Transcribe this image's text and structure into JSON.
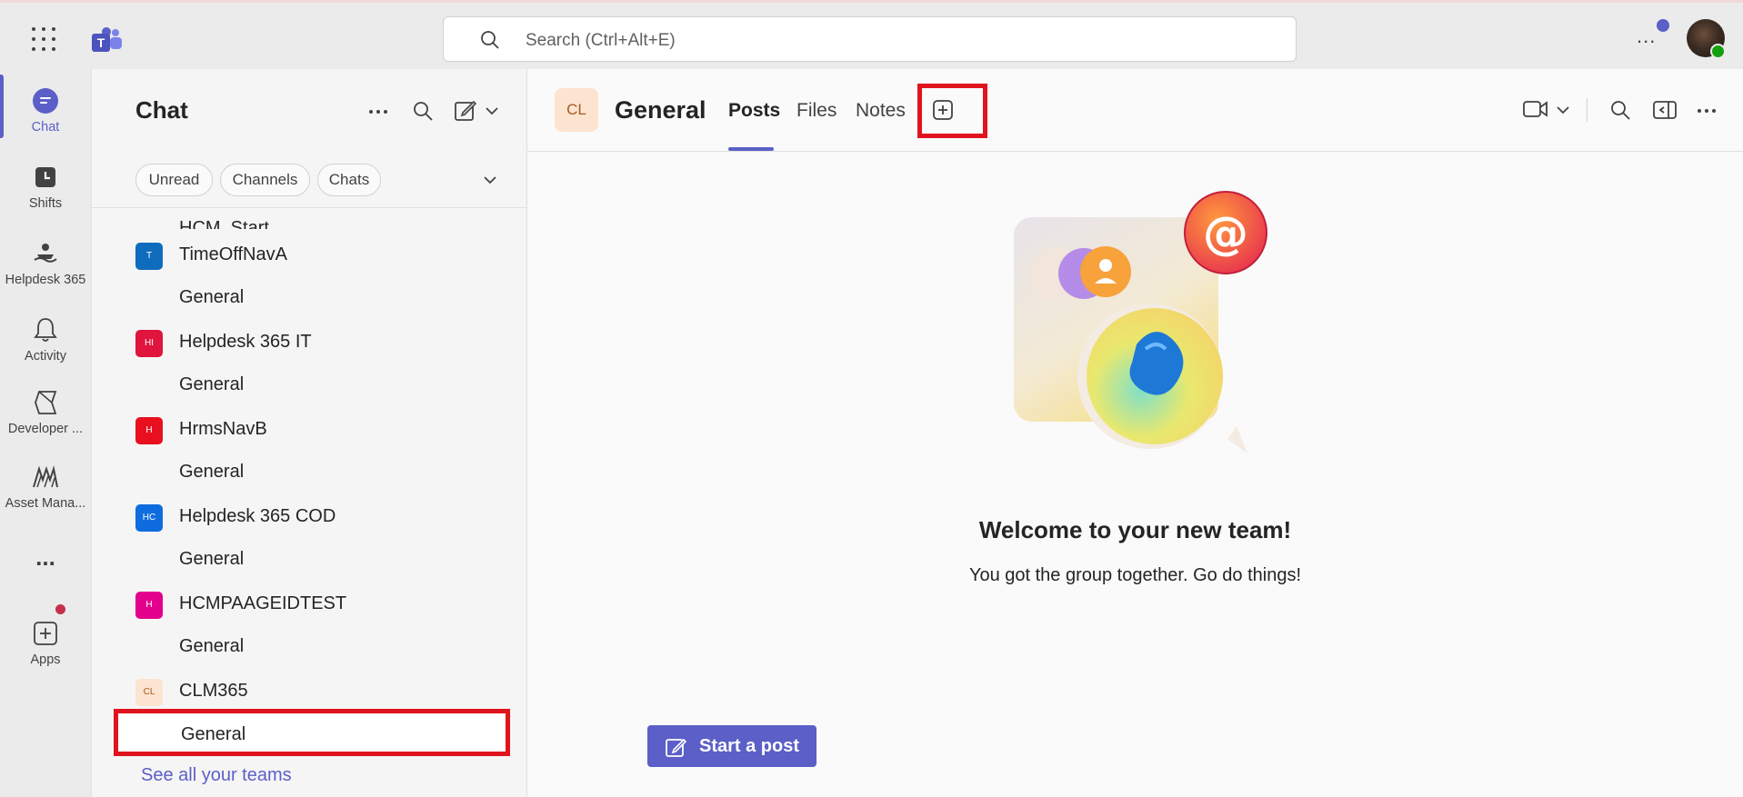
{
  "topbar": {
    "search_placeholder": "Search (Ctrl+Alt+E)",
    "more": "..."
  },
  "rail": {
    "items": [
      {
        "label": "Chat",
        "icon": "chat-icon"
      },
      {
        "label": "Shifts",
        "icon": "shifts-icon"
      },
      {
        "label": "Helpdesk 365",
        "icon": "helpdesk-icon"
      },
      {
        "label": "Activity",
        "icon": "bell-icon"
      },
      {
        "label": "Developer ...",
        "icon": "developer-icon"
      },
      {
        "label": "Asset Mana...",
        "icon": "asset-icon"
      },
      {
        "label": "...",
        "icon": "more-icon"
      },
      {
        "label": "Apps",
        "icon": "add-apps-icon"
      }
    ]
  },
  "chat_panel": {
    "title": "Chat",
    "filters": [
      "Unread",
      "Channels",
      "Chats"
    ],
    "partial_item": "HCM_Start",
    "teams": [
      {
        "badge": "T",
        "name": "TimeOffNavA",
        "channel": "General",
        "color": "#0f6cbd"
      },
      {
        "badge": "HI",
        "name": "Helpdesk 365 IT",
        "channel": "General",
        "color": "#e0143d"
      },
      {
        "badge": "H",
        "name": "HrmsNavB",
        "channel": "General",
        "color": "#e8101e"
      },
      {
        "badge": "HC",
        "name": "Helpdesk 365 COD",
        "channel": "General",
        "color": "#0f6cde"
      },
      {
        "badge": "H",
        "name": "HCMPAAGEIDTEST",
        "channel": "General",
        "color": "#e3008c"
      },
      {
        "badge": "CL",
        "name": "CLM365",
        "channel": "General",
        "color": "#fce4d0"
      }
    ],
    "see_all": "See all your teams"
  },
  "main": {
    "team_avatar": "CL",
    "channel_title": "General",
    "tabs": [
      "Posts",
      "Files",
      "Notes"
    ],
    "welcome_title": "Welcome to your new team!",
    "welcome_sub": "You got the group together. Go do things!",
    "start_post": "Start a post"
  },
  "colors": {
    "accent": "#5b5fc7",
    "highlight_box": "#e0141e"
  }
}
